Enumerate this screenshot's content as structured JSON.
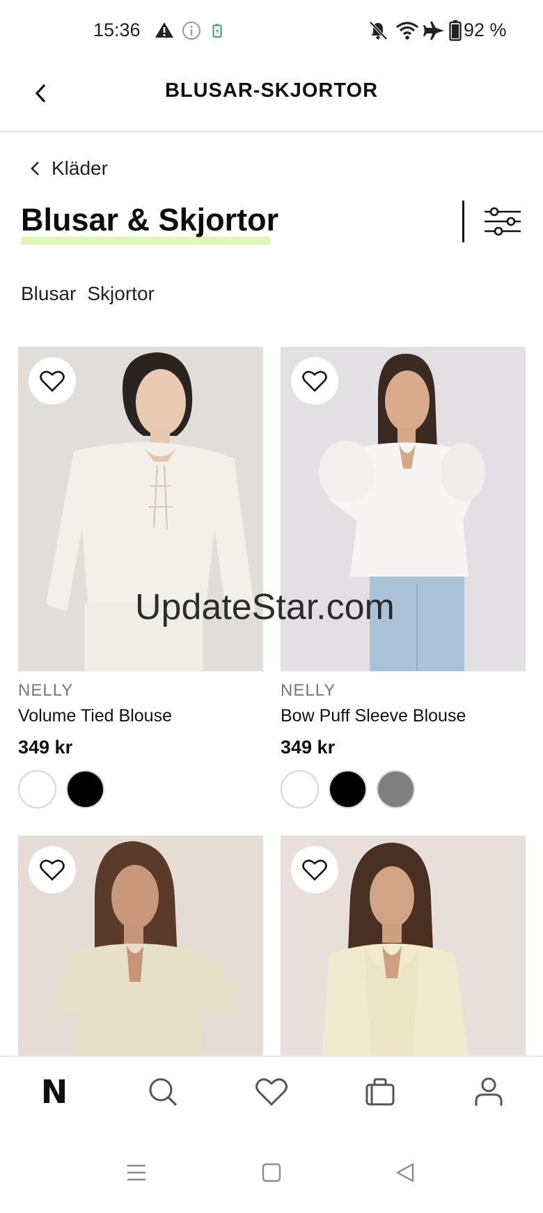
{
  "status_bar": {
    "time": "15:36",
    "battery_percent": "92 %",
    "icons": [
      "warning-icon",
      "info-icon",
      "battery-saver-icon",
      "bell-off-icon",
      "wifi-icon",
      "airplane-icon",
      "battery-icon"
    ]
  },
  "app_bar": {
    "title": "BLUSAR-SKJORTOR",
    "back_icon": "chevron-left-icon"
  },
  "breadcrumb": {
    "label": "Kläder"
  },
  "page": {
    "title": "Blusar & Skjortor",
    "title_highlight_color": "#dcf7b6",
    "filter_icon": "filter-sliders-icon"
  },
  "subcategories": [
    "Blusar",
    "Skjortor"
  ],
  "products": [
    {
      "brand": "NELLY",
      "name": "Volume Tied Blouse",
      "price": "349 kr",
      "colors": [
        "#ffffff",
        "#000000"
      ],
      "favorite": false
    },
    {
      "brand": "NELLY",
      "name": "Bow Puff Sleeve Blouse",
      "price": "349 kr",
      "colors": [
        "#ffffff",
        "#000000",
        "#808080"
      ],
      "favorite": false
    },
    {
      "brand": "",
      "name": "",
      "price": "",
      "colors": [],
      "favorite": false
    },
    {
      "brand": "",
      "name": "",
      "price": "",
      "colors": [],
      "favorite": false
    }
  ],
  "watermark": "UpdateStar.com",
  "bottom_nav": {
    "items": [
      {
        "name": "home",
        "label": "N",
        "icon": "nelly-logo-icon"
      },
      {
        "name": "search",
        "icon": "search-icon"
      },
      {
        "name": "favorites",
        "icon": "heart-icon"
      },
      {
        "name": "bag",
        "icon": "shopping-bag-icon"
      },
      {
        "name": "account",
        "icon": "user-icon"
      }
    ]
  },
  "system_nav": {
    "items": [
      "menu-icon",
      "home-square-icon",
      "back-triangle-icon"
    ]
  }
}
